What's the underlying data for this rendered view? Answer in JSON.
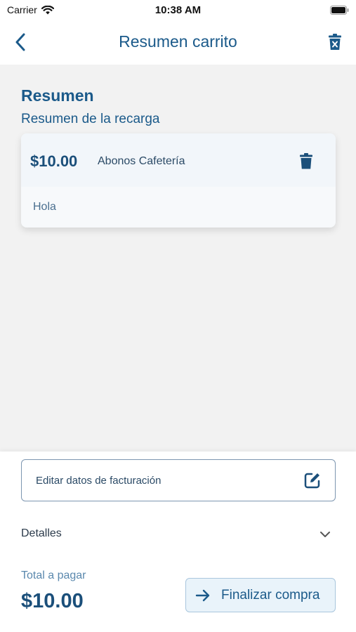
{
  "status_bar": {
    "carrier": "Carrier",
    "time": "10:38 AM",
    "icons": [
      "wifi-icon",
      "battery-icon"
    ]
  },
  "nav": {
    "title": "Resumen carrito",
    "back_icon": "chevron-left-icon",
    "clear_icon": "trash-x-icon"
  },
  "summary": {
    "title": "Resumen",
    "subtitle": "Resumen de la recarga",
    "items": [
      {
        "price": "$10.00",
        "name": "Abonos Cafetería",
        "note": "Hola",
        "delete_icon": "trash-icon"
      }
    ]
  },
  "footer": {
    "billing_label": "Editar datos de facturación",
    "billing_icon": "edit-icon",
    "details_label": "Detalles",
    "details_icon": "chevron-down-icon",
    "total_label": "Total a pagar",
    "total_value": "$10.00",
    "checkout_label": "Finalizar compra",
    "checkout_icon": "arrow-right-icon"
  },
  "colors": {
    "primary": "#1b5a8a",
    "background": "#f2f2f2",
    "card": "#f2f6fa",
    "checkout_bg": "#e9f3fa"
  }
}
